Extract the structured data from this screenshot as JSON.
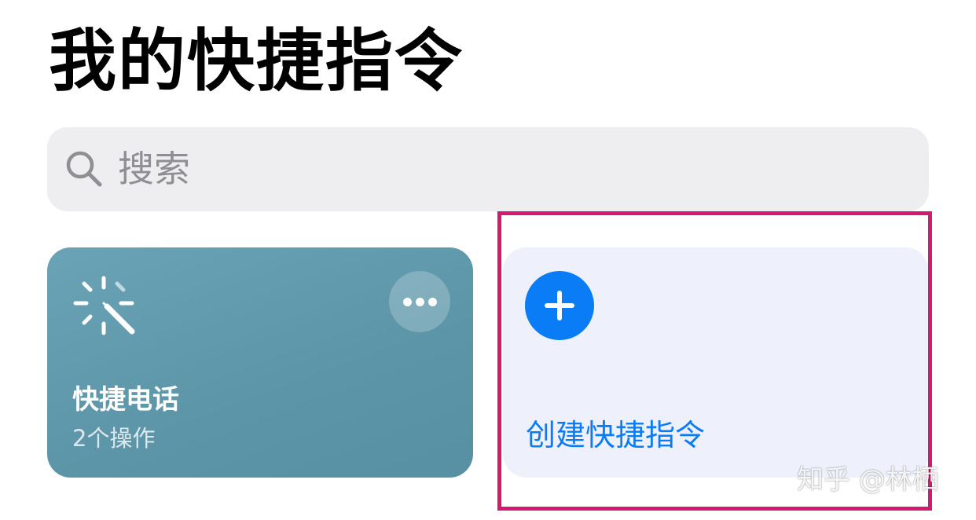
{
  "header": {
    "title": "我的快捷指令"
  },
  "search": {
    "placeholder": "搜索",
    "icon": "search-icon"
  },
  "shortcuts": [
    {
      "name": "快捷电话",
      "actions": "2个操作",
      "icon": "magic-wand-icon",
      "color": "#6aa3b5"
    }
  ],
  "create": {
    "label": "创建快捷指令",
    "icon": "plus-icon",
    "accent": "#0a7cf5"
  },
  "highlight": {
    "color": "#d4196e"
  },
  "watermark": {
    "text": "知乎 @林栖"
  }
}
